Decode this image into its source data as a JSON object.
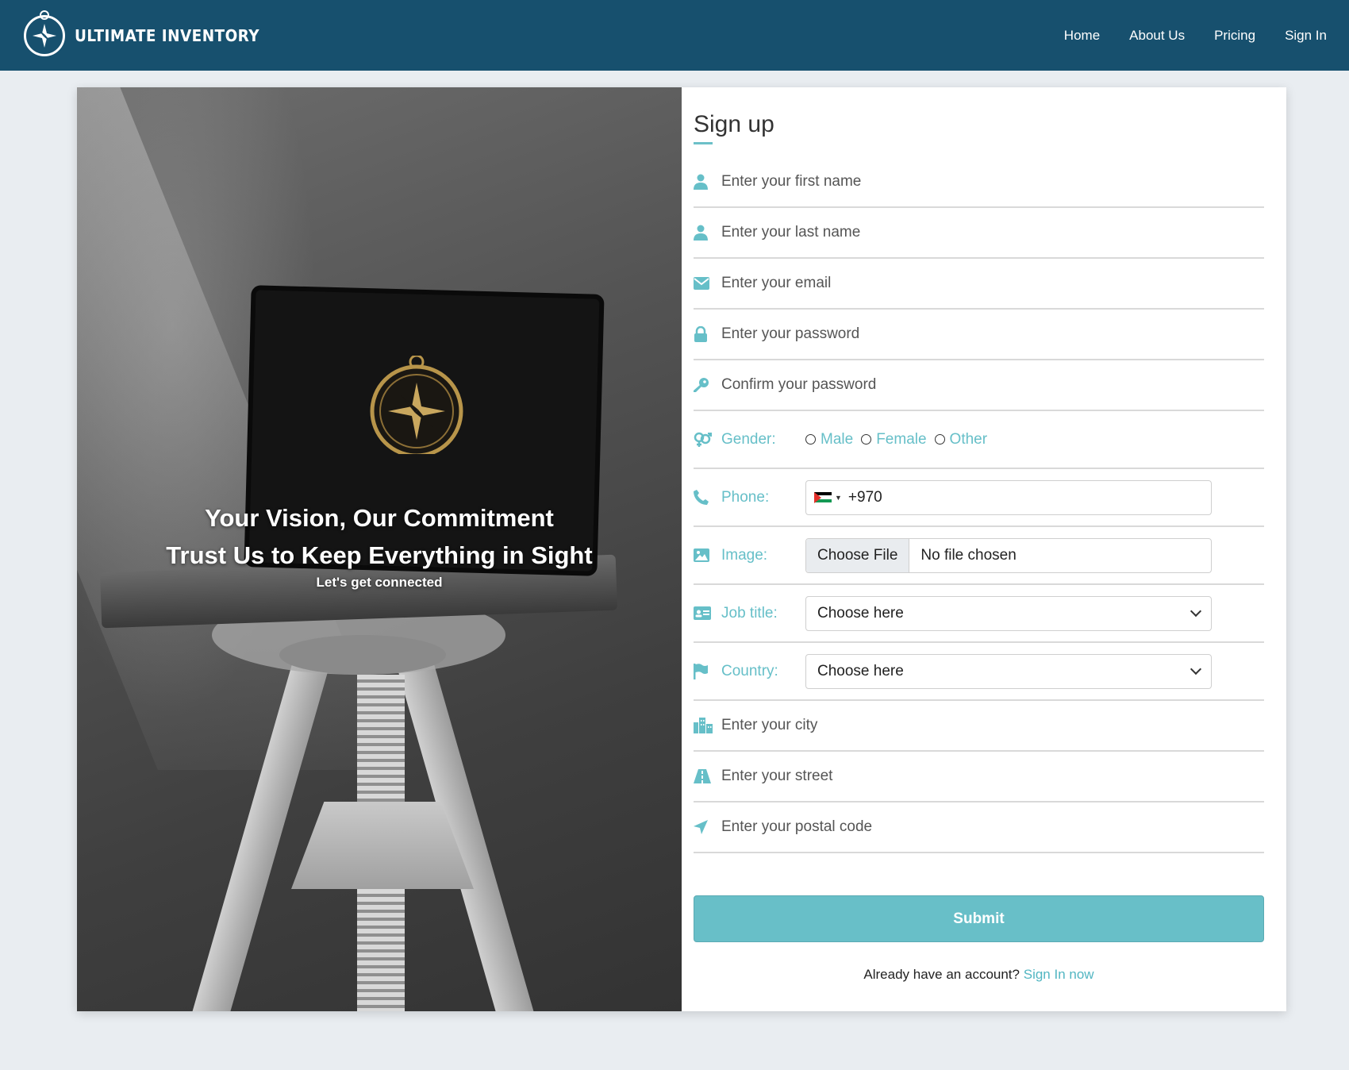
{
  "navbar": {
    "brand": "ULTIMATE INVENTORY",
    "links": [
      "Home",
      "About Us",
      "Pricing",
      "Sign In"
    ]
  },
  "hero": {
    "line1": "Your Vision, Our Commitment",
    "line2": "Trust Us to Keep Everything in Sight",
    "line3": "Let's get connected"
  },
  "form": {
    "title": "Sign up",
    "first_name_placeholder": "Enter your first name",
    "last_name_placeholder": "Enter your last name",
    "email_placeholder": "Enter your email",
    "password_placeholder": "Enter your password",
    "confirm_password_placeholder": "Confirm your password",
    "gender_label": "Gender:",
    "gender_options": [
      "Male",
      "Female",
      "Other"
    ],
    "phone_label": "Phone:",
    "phone_value": "+970",
    "image_label": "Image:",
    "choose_file": "Choose File",
    "no_file": "No file chosen",
    "job_title_label": "Job title:",
    "job_title_value": "Choose here",
    "country_label": "Country:",
    "country_value": "Choose here",
    "city_placeholder": "Enter your city",
    "street_placeholder": "Enter your street",
    "postal_placeholder": "Enter your postal code",
    "submit": "Submit",
    "already_text": "Already have an account?",
    "signin_link": "Sign In now"
  },
  "colors": {
    "navbar": "#17506e",
    "accent": "#66bfc8",
    "submit": "#68bfc8",
    "page_bg": "#e9edf1"
  },
  "icons": {
    "first_name": "user-icon",
    "last_name": "user-icon",
    "email": "envelope-icon",
    "password": "lock-icon",
    "confirm_password": "key-icon",
    "gender": "venus-mars-icon",
    "phone": "phone-icon",
    "image": "image-icon",
    "job_title": "id-card-icon",
    "country": "flag-icon",
    "city": "city-icon",
    "street": "road-icon",
    "postal": "location-arrow-icon"
  }
}
